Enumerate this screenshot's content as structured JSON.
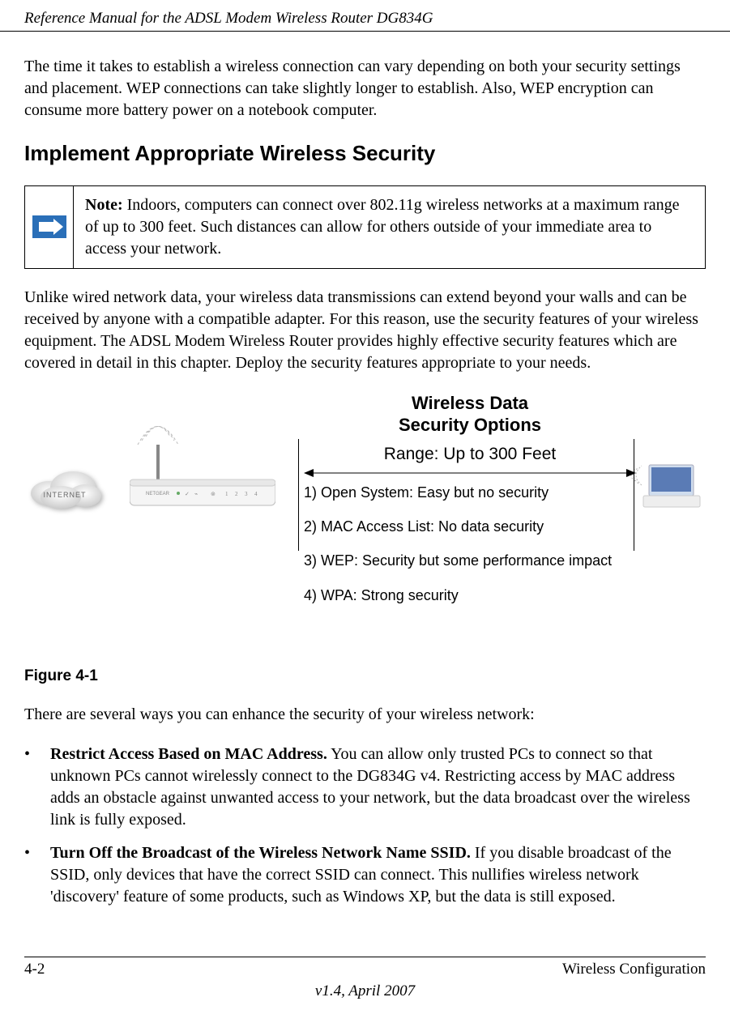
{
  "header_title": "Reference Manual for the ADSL Modem Wireless Router DG834G",
  "intro_para": "The time it takes to establish a wireless connection can vary depending on both your security settings and placement. WEP connections can take slightly longer to establish. Also, WEP encryption can consume more battery power on a notebook computer.",
  "h2": "Implement Appropriate Wireless Security",
  "note": {
    "label": "Note:",
    "body": "Indoors, computers can connect over 802.11g wireless networks at a maximum range of up to 300 feet. Such distances can allow for others outside of your immediate area to access your network."
  },
  "para2": "Unlike wired network data, your wireless data transmissions can extend beyond your walls and can be received by anyone with a compatible adapter. For this reason, use the security features of your wireless equipment. The ADSL Modem Wireless Router provides highly effective security features which are covered in detail in this chapter. Deploy the security features appropriate to your needs.",
  "figure": {
    "caption": "Figure 4-1",
    "title_line1": "Wireless Data",
    "title_line2": "Security Options",
    "range": "Range: Up to 300 Feet",
    "cloud_label": "INTERNET",
    "router_label": "NETGEAR",
    "options": [
      "1) Open System: Easy but no security",
      "2) MAC Access List: No data security",
      "3) WEP: Security but some performance impact",
      "4) WPA: Strong security"
    ]
  },
  "para3": "There are several ways you can enhance the security of your wireless network:",
  "bullets": [
    {
      "bold": "Restrict Access Based on MAC Address.",
      "rest": " You can allow only trusted PCs to connect so that unknown PCs cannot wirelessly connect to the DG834G v4. Restricting access by MAC address adds an obstacle against unwanted access to your network, but the data broadcast over the wireless link is fully exposed."
    },
    {
      "bold": "Turn Off the Broadcast of the Wireless Network Name SSID.",
      "rest": " If you disable broadcast of the SSID, only devices that have the correct SSID can connect. This nullifies wireless network 'discovery' feature of some products, such as Windows XP, but the data is still exposed."
    }
  ],
  "footer": {
    "page": "4-2",
    "section": "Wireless Configuration",
    "version": "v1.4, April 2007"
  }
}
